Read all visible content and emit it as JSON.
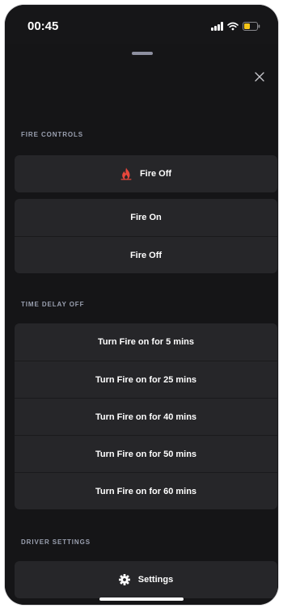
{
  "status_bar": {
    "time": "00:45",
    "icons": [
      "signal-icon",
      "wifi-icon",
      "battery-icon"
    ],
    "battery_color": "#f5c518"
  },
  "sheet": {
    "close_icon": "close-icon"
  },
  "fire_controls": {
    "label": "FIRE CONTROLS",
    "status": {
      "label": "Fire Off",
      "icon": "flame-icon",
      "icon_color": "#e8473c"
    },
    "actions": [
      {
        "label": "Fire On"
      },
      {
        "label": "Fire Off"
      }
    ]
  },
  "time_delay": {
    "label": "TIME DELAY OFF",
    "options": [
      {
        "label": "Turn Fire on for 5 mins"
      },
      {
        "label": "Turn Fire on for 25 mins"
      },
      {
        "label": "Turn Fire on for 40 mins"
      },
      {
        "label": "Turn Fire on for 50 mins"
      },
      {
        "label": "Turn Fire on for 60 mins"
      }
    ]
  },
  "driver_settings": {
    "label": "DRIVER SETTINGS",
    "settings": {
      "label": "Settings",
      "icon": "gear-icon"
    }
  }
}
